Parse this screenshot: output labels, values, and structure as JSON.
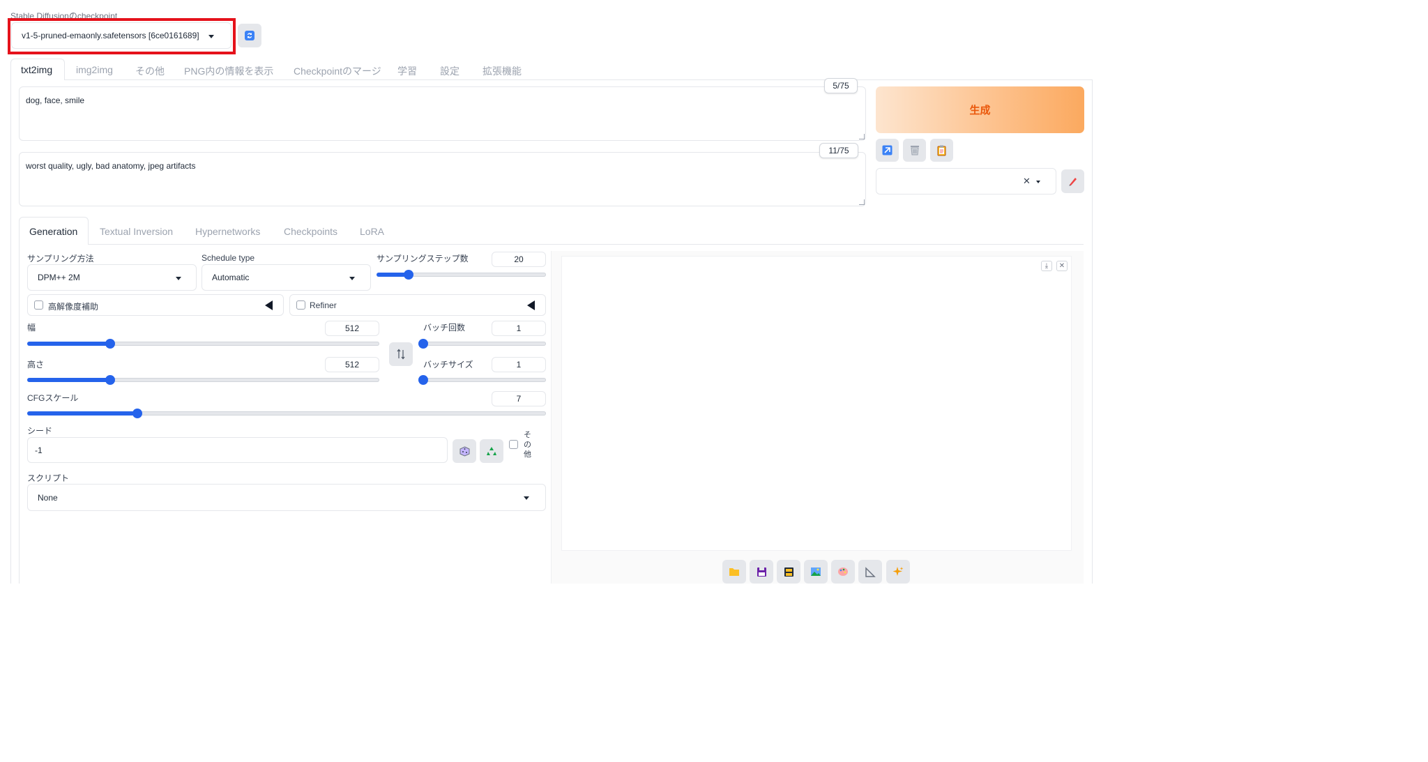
{
  "checkpoint": {
    "label": "Stable Diffusionのcheckpoint",
    "value": "v1-5-pruned-emaonly.safetensors [6ce0161689]",
    "highlight_color": "#e5121b"
  },
  "main_tabs": [
    "txt2img",
    "img2img",
    "その他",
    "PNG内の情報を表示",
    "Checkpointのマージ",
    "学習",
    "設定",
    "拡張機能"
  ],
  "prompt": {
    "value": "dog, face, smile",
    "counter": "5/75"
  },
  "negative_prompt": {
    "value": "worst quality, ugly, bad anatomy, jpeg artifacts",
    "counter": "11/75"
  },
  "generate": {
    "label": "生成",
    "color": "#f97316"
  },
  "sub_tabs": [
    "Generation",
    "Textual Inversion",
    "Hypernetworks",
    "Checkpoints",
    "LoRA"
  ],
  "sampling": {
    "label": "サンプリング方法",
    "value": "DPM++ 2M"
  },
  "schedule": {
    "label": "Schedule type",
    "value": "Automatic"
  },
  "steps": {
    "label": "サンプリングステップ数",
    "value": "20",
    "fraction": 0.19
  },
  "hires": {
    "label": "高解像度補助"
  },
  "refiner": {
    "label": "Refiner"
  },
  "width": {
    "label": "幅",
    "value": "512",
    "fraction": 0.235
  },
  "height": {
    "label": "高さ",
    "value": "512",
    "fraction": 0.235
  },
  "batch_count": {
    "label": "バッチ回数",
    "value": "1",
    "fraction": 0.0
  },
  "batch_size": {
    "label": "バッチサイズ",
    "value": "1",
    "fraction": 0.0
  },
  "cfg": {
    "label": "CFGスケール",
    "value": "7",
    "fraction": 0.213
  },
  "seed": {
    "label": "シード",
    "value": "-1",
    "extra": "その他"
  },
  "script": {
    "label": "スクリプト",
    "value": "None"
  },
  "icons": {
    "refresh": "refresh-icon",
    "swap": "swap-icon",
    "dice": "dice-icon",
    "recycle": "recycle-icon",
    "output_tools": [
      "folder-icon",
      "save-icon",
      "zip-icon",
      "image-icon",
      "palette-icon",
      "ruler-icon",
      "sparkle-icon"
    ]
  },
  "accent_color": "#2563eb"
}
